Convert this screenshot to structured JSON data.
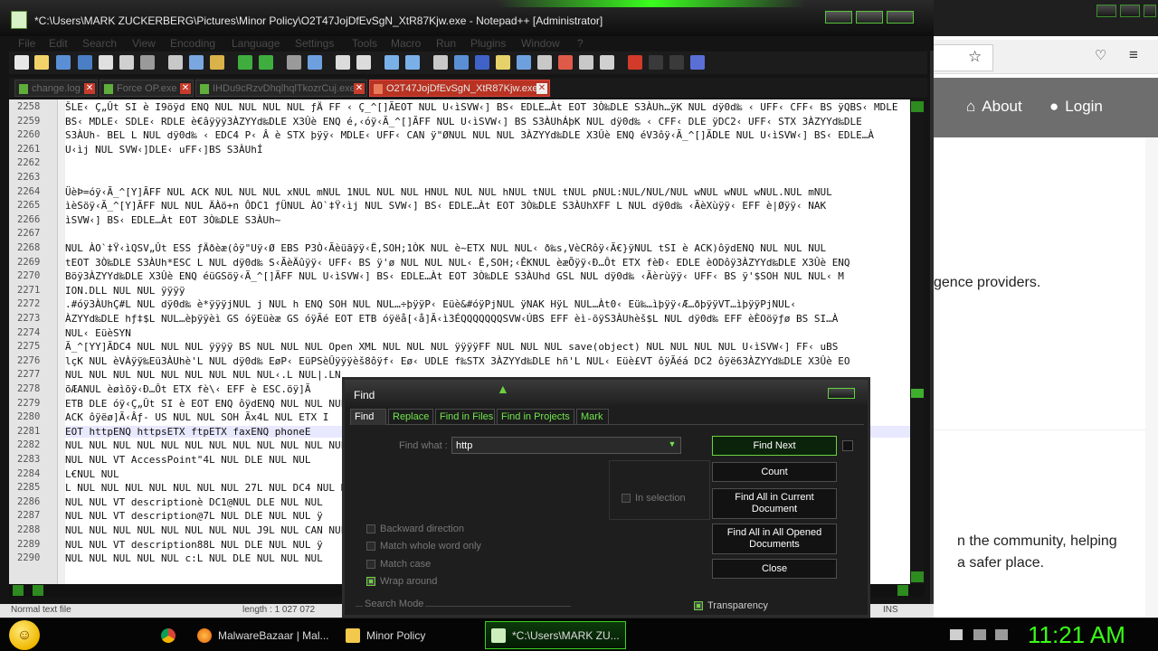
{
  "npp": {
    "title": "*C:\\Users\\MARK ZUCKERBERG\\Pictures\\Minor Policy\\O2T47JojDfEvSgN_XtR87Kjw.exe - Notepad++ [Administrator]",
    "menu": [
      "File",
      "Edit",
      "Search",
      "View",
      "Encoding",
      "Language",
      "Settings",
      "Tools",
      "Macro",
      "Run",
      "Plugins",
      "Window",
      "?"
    ],
    "tabs": [
      {
        "label": "change.log",
        "active": false
      },
      {
        "label": "Force OP.exe",
        "active": false
      },
      {
        "label": "IHDu9cRzvDhqlhqlTkozrCuj.exe",
        "active": false
      },
      {
        "label": "O2T47JojDfEvSgN_XtR87Kjw.exe",
        "active": true
      }
    ],
    "lines": [
      {
        "n": "2258",
        "t": "ŠLE‹ Ç„Ût SI è I9öÿd ENQ NUL NUL NUL NUL ƒÄ FF ‹ Ç_^[]ÃEOT NUL U‹ìSVW‹] BS‹ EDLE…Àt EOT 3Ò‰DLE S3ÀUh…ÿK NUL dÿ0d‰ ‹ UFF‹ CFF‹ BS ÿQBS‹ MDLE"
      },
      {
        "n": "2259",
        "t": "BS‹ MDLE‹ SDLE‹ RDLE è€âÿÿÿ3ÀZYYd‰DLE X3Ûè ENQ é,‹óÿ‹Ã_^[]ÃFF NUL U‹ìSVW‹] BS S3ÀUhÁþK NUL dÿ0d‰ ‹ CFF‹ DLE ÿDC2‹ UFF‹ STX 3ÀZYYd‰DLE"
      },
      {
        "n": "2260",
        "t": "S3ÀUh- BEL L NUL dÿ0d‰ ‹ EDC4 P‹ Â è STX þÿÿ‹ MDLE‹ UFF‹ CAN ÿ\"ØNUL NUL NUL 3ÀZYYd‰DLE X3Ûè ENQ éV3ôÿ‹Ã_^[]ÃDLE NUL U‹ìSVW‹] BS‹ EDLE…À"
      },
      {
        "n": "2261",
        "t": "U‹ìj NUL SVW‹]DLE‹ uFF‹]BS S3ÀUhÍ"
      },
      {
        "n": "2262",
        "t": ""
      },
      {
        "n": "2263",
        "t": ""
      },
      {
        "n": "2264",
        "t": "ÜèÞ=óÿ‹Ã_^[Y]ÃFF NUL ACK NUL NUL NUL xNUL mNUL 1NUL NUL NUL HNUL NUL NUL hNUL tNUL tNUL pNUL:NUL/NUL/NUL wNUL wNUL wNUL.NUL mNUL"
      },
      {
        "n": "2265",
        "t": "ìèSöÿ‹Ã_^[Y]ÃFF NUL NUL ÄÀö+n   ÔDC1 ƒÜNUL ÀO`‡Ÿ‹ìj NUL SVW‹] BS‹ EDLE…Àt EOT 3Ò‰DLE S3ÀUhXFF L NUL dÿ0d‰ ‹ÃèXùÿÿ‹ EFF è|Øÿÿ‹ NAK"
      },
      {
        "n": "2266",
        "t": "ìSVW‹] BS‹ EDLE…Àt EOT 3Ò‰DLE S3ÀUh~"
      },
      {
        "n": "2267",
        "t": ""
      },
      {
        "n": "2268",
        "t": "NUL ÀO`‡Ÿ‹ìQSV„Ût ESS ƒÄðèæ(ôÿ\"Uÿ‹Ø EBS P3Ò‹Ãèüãÿÿ‹Ë‚SOH;1ÒK NUL è~ETX NUL NUL‹ ð‰s,VèCRôÿ‹Ã€}ÿNUL tSI è ACK)ôÿdENQ NUL NUL NUL"
      },
      {
        "n": "2269",
        "t": "tEOT 3Ò‰DLE S3ÀUh*ESC L NUL dÿ0d‰ S‹ÃèÄûÿÿ‹ UFF‹ BS ÿ'ø NUL NUL NUL‹ Ë‚SOH;‹ÊKNUL èæÕÿÿ‹Ð…Ôt ETX fèÐ‹ EDLE èODôÿ3ÀZYYd‰DLE X3Ûè ENQ"
      },
      {
        "n": "2270",
        "t": "Böÿ3ÀZYYd‰DLE X3Ûè ENQ éüGSöÿ‹Ã_^[]ÃFF NUL U‹ìSVW‹] BS‹ EDLE…Àt EOT 3Ò‰DLE S3ÀUhd GSL NUL dÿ0d‰ ‹Ãèrùÿÿ‹ UFF‹ BS ÿ'$SOH NUL NUL‹ M"
      },
      {
        "n": "2271",
        "t": "ION.DLL NUL NUL ÿÿÿÿ"
      },
      {
        "n": "2272",
        "t": ".#óÿ3ÀUhÇ#L NUL dÿ0d‰ è*ÿÿÿjNUL j NUL h ENQ SOH NUL NUL…÷þÿÿP‹ Eüè&#óÿPjNUL ÿNAK HÿL NUL…Àt0‹ Eü‰…ìþÿÿ‹Æ…ðþÿÿVT…ìþÿÿPjNUL‹"
      },
      {
        "n": "2273",
        "t": "ÀZYYd‰DLE hƒ‡$L NUL…èþÿÿèì GS óÿEüèæ GS óÿÃé EOT ETB óÿëå[‹å]Ã‹ì3ÉQQQQQQQSVW‹ÚBS EFF èì-õÿS3ÀUhèš$L NUL dÿ0d‰ EFF èÈOöÿƒø BS SI…À"
      },
      {
        "n": "2274",
        "t": "NUL‹ EüèSYN"
      },
      {
        "n": "2275",
        "t": "Ã_^[YY]ÃDC4 NUL NUL NUL ÿÿÿÿ BS NUL NUL NUL Open XML NUL NUL NUL ÿÿÿÿFF NUL NUL NUL save(object) NUL NUL NUL NUL U‹ìSVW‹] FF‹ uBS"
      },
      {
        "n": "2276",
        "t": "lçK NUL èVÀÿÿ‰Eü3ÀUhè'L NUL dÿ0d‰ EøP‹ EüPSèÛÿÿÿèš8ôÿf‹ Eø‹ UDLE f‰STX 3ÀZYYd‰DLE hñ'L NUL‹ Eüè£VT ôÿÃéá DC2 ôÿë63ÀZYYd‰DLE X3Ûè EO"
      },
      {
        "n": "2277",
        "t": "NUL NUL NUL NUL NUL NUL NUL NUL NUL‹.L NUL|.LN"
      },
      {
        "n": "2278",
        "t": "õÆANUL èøìõÿ‹Ð…Ôt ETX fè\\‹ EFF è ESC.öÿ]Ã"
      },
      {
        "n": "2279",
        "t": "ETB DLE óÿ‹Ç„Ût SI è EOT ENQ ôÿdENQ NUL NUL NUL"
      },
      {
        "n": "2280",
        "t": "ACK ôÿëø]Ã‹Âƒ-  US NUL NUL SOH Ãx4L NUL ETX  I"
      },
      {
        "n": "2281",
        "t": "EOT httpENQ httpsETX ftpETX faxENQ phoneE"
      },
      {
        "n": "2282",
        "t": "NUL NUL NUL NUL NUL NUL NUL NUL NUL NUL NUL NUL"
      },
      {
        "n": "2283",
        "t": "NUL NUL VT AccessPoint\"4L NUL DLE NUL NUL"
      },
      {
        "n": "2284",
        "t": "L€NUL NUL"
      },
      {
        "n": "2285",
        "t": "L NUL NUL NUL NUL NUL NUL NUL 27L NUL DC4 NUL NUL"
      },
      {
        "n": "2286",
        "t": "NUL NUL VT descriptionè DC1@NUL DLE NUL NUL"
      },
      {
        "n": "2287",
        "t": "NUL NUL VT description@7L NUL DLE NUL NUL ÿ"
      },
      {
        "n": "2288",
        "t": "NUL NUL NUL NUL NUL NUL NUL NUL J9L NUL CAN NUL"
      },
      {
        "n": "2289",
        "t": "NUL NUL VT description88L NUL DLE NUL NUL ÿ"
      },
      {
        "n": "2290",
        "t": "NUL NUL NUL NUL NUL c:L NUL DLE NUL NUL NUL"
      }
    ],
    "status": {
      "type": "Normal text file",
      "length": "length : 1 027 072",
      "ins": "INS"
    }
  },
  "find": {
    "title": "Find",
    "tabs": [
      "Find",
      "Replace",
      "Find in Files",
      "Find in Projects",
      "Mark"
    ],
    "find_what_label": "Find what :",
    "find_what_value": "http",
    "buttons": {
      "find_next": "Find Next",
      "count": "Count",
      "find_all_current": "Find All in Current Document",
      "find_all_opened": "Find All in All Opened Documents",
      "close": "Close"
    },
    "in_selection": "In selection",
    "options": [
      {
        "label": "Backward direction",
        "checked": false
      },
      {
        "label": "Match whole word only",
        "checked": false
      },
      {
        "label": "Match case",
        "checked": false
      },
      {
        "label": "Wrap around",
        "checked": true
      }
    ],
    "search_mode": "Search Mode",
    "transparency": "Transparency"
  },
  "browser": {
    "nav": {
      "about": "About",
      "login": "Login"
    },
    "text1": "gence providers.",
    "text2": "n the community, helping",
    "text3": "a safer place."
  },
  "taskbar": {
    "items": [
      {
        "label": "",
        "icon": "chrome-icon"
      },
      {
        "label": "MalwareBazaar | Mal...",
        "icon": "firefox-icon"
      },
      {
        "label": "Minor Policy",
        "icon": "folder-icon"
      },
      {
        "label": "*C:\\Users\\MARK ZU...",
        "icon": "notepadpp-icon"
      }
    ],
    "clock": "11:21 AM"
  }
}
